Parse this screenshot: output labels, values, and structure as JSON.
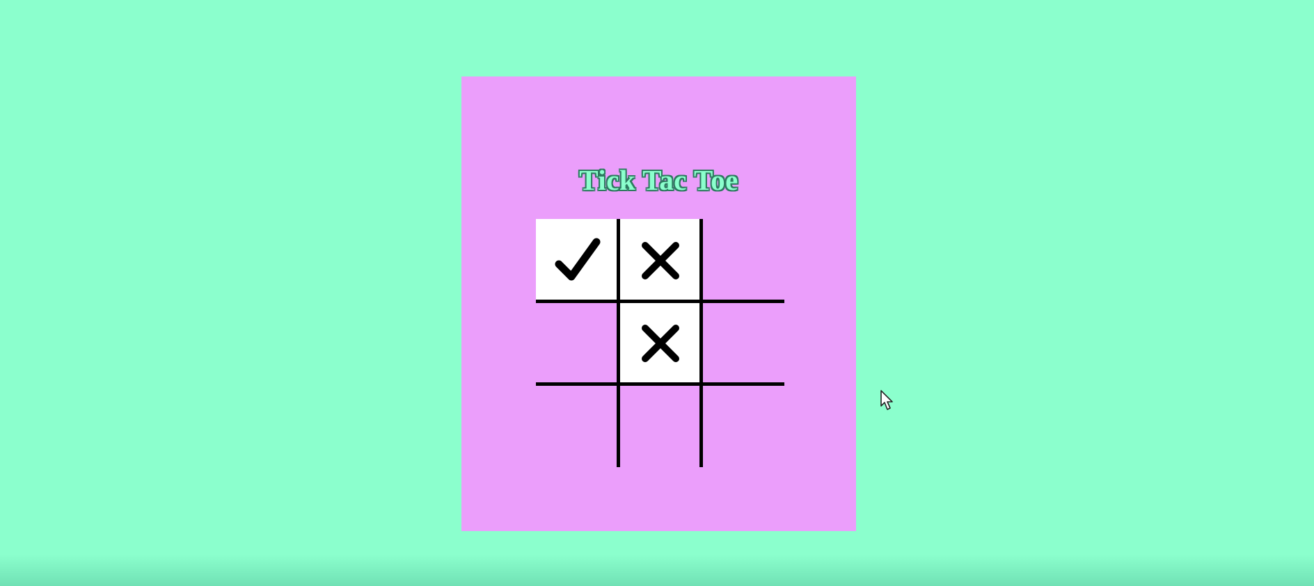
{
  "game": {
    "title": "Tick Tac Toe",
    "board": [
      [
        "check",
        "x",
        ""
      ],
      [
        "",
        "x",
        ""
      ],
      [
        "",
        "",
        ""
      ]
    ]
  },
  "colors": {
    "background": "#8bffcd",
    "panel": "#eb9efb",
    "cell_filled": "#ffffff",
    "grid_line": "#000000",
    "title_fill": "#8bffcd",
    "title_outline": "#2e7a60"
  },
  "icons": {
    "check": "check-mark-icon",
    "x": "x-mark-icon",
    "cursor": "mouse-pointer-icon"
  }
}
